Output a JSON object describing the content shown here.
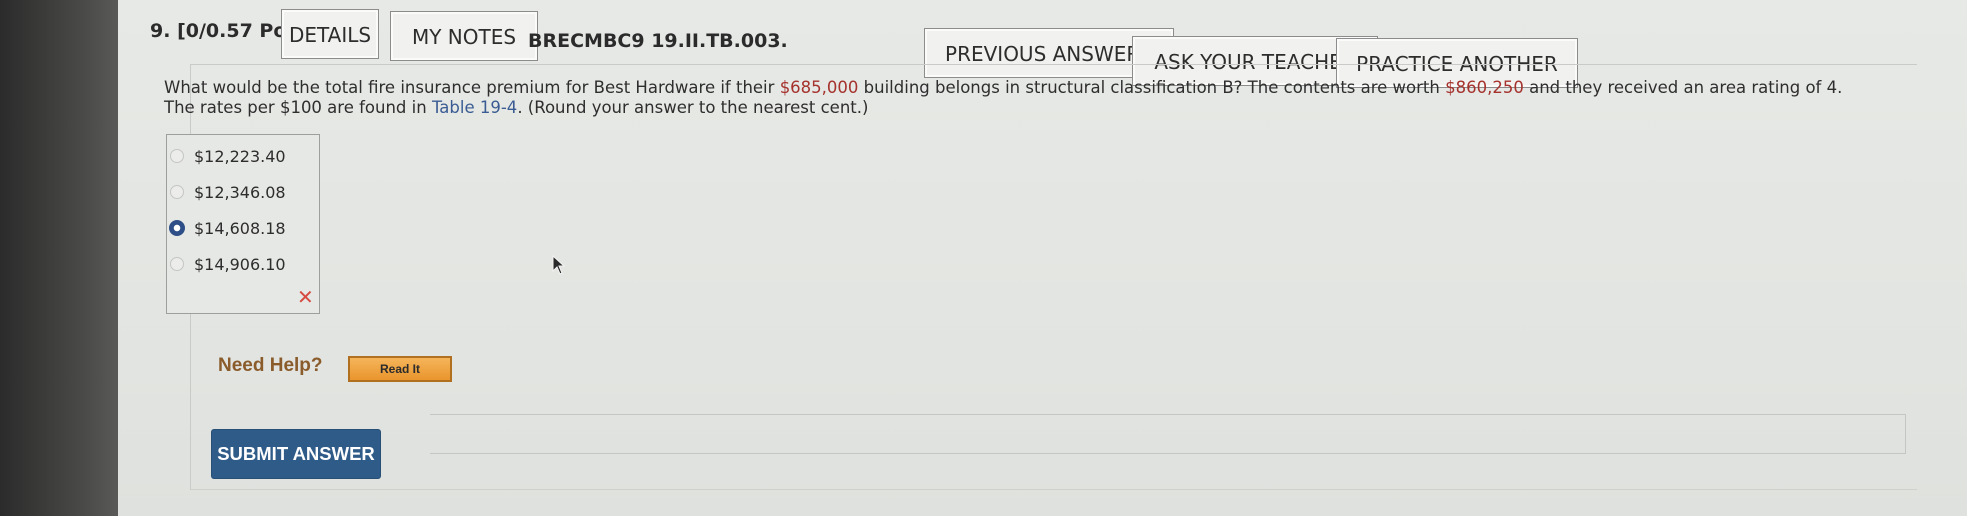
{
  "header": {
    "question_number": "9.",
    "points": "[0/0.57 Points]",
    "details_label": "DETAILS",
    "my_notes_label": "MY NOTES",
    "problem_code": "BRECMBC9 19.II.TB.003.",
    "previous_answers_label": "PREVIOUS ANSWERS",
    "ask_teacher_label": "ASK YOUR TEACHER",
    "practice_another_label": "PRACTICE ANOTHER"
  },
  "question": {
    "text_1": "What would be the total fire insurance premium for Best Hardware if their ",
    "building_value": "$685,000",
    "text_2": " building belongs in structural classification B? The contents are worth ",
    "contents_value": "$860,250",
    "text_3": " and they received an area rating of 4. The rates per $100 are found in ",
    "table_link": "Table 19-4",
    "text_4": ". (Round your answer to the nearest cent.)"
  },
  "choices": [
    {
      "label": "$12,223.40",
      "selected": false
    },
    {
      "label": "$12,346.08",
      "selected": false
    },
    {
      "label": "$14,608.18",
      "selected": true
    },
    {
      "label": "$14,906.10",
      "selected": false
    }
  ],
  "result_mark": "✕",
  "help": {
    "need_help_label": "Need Help?",
    "read_it_label": "Read It"
  },
  "submit_label": "SUBMIT ANSWER",
  "colors": {
    "accent": "#2f5b88",
    "error": "#d64a3f",
    "value_red": "#a5322d",
    "link": "#3a5c93",
    "help_orange": "#e9952d"
  }
}
